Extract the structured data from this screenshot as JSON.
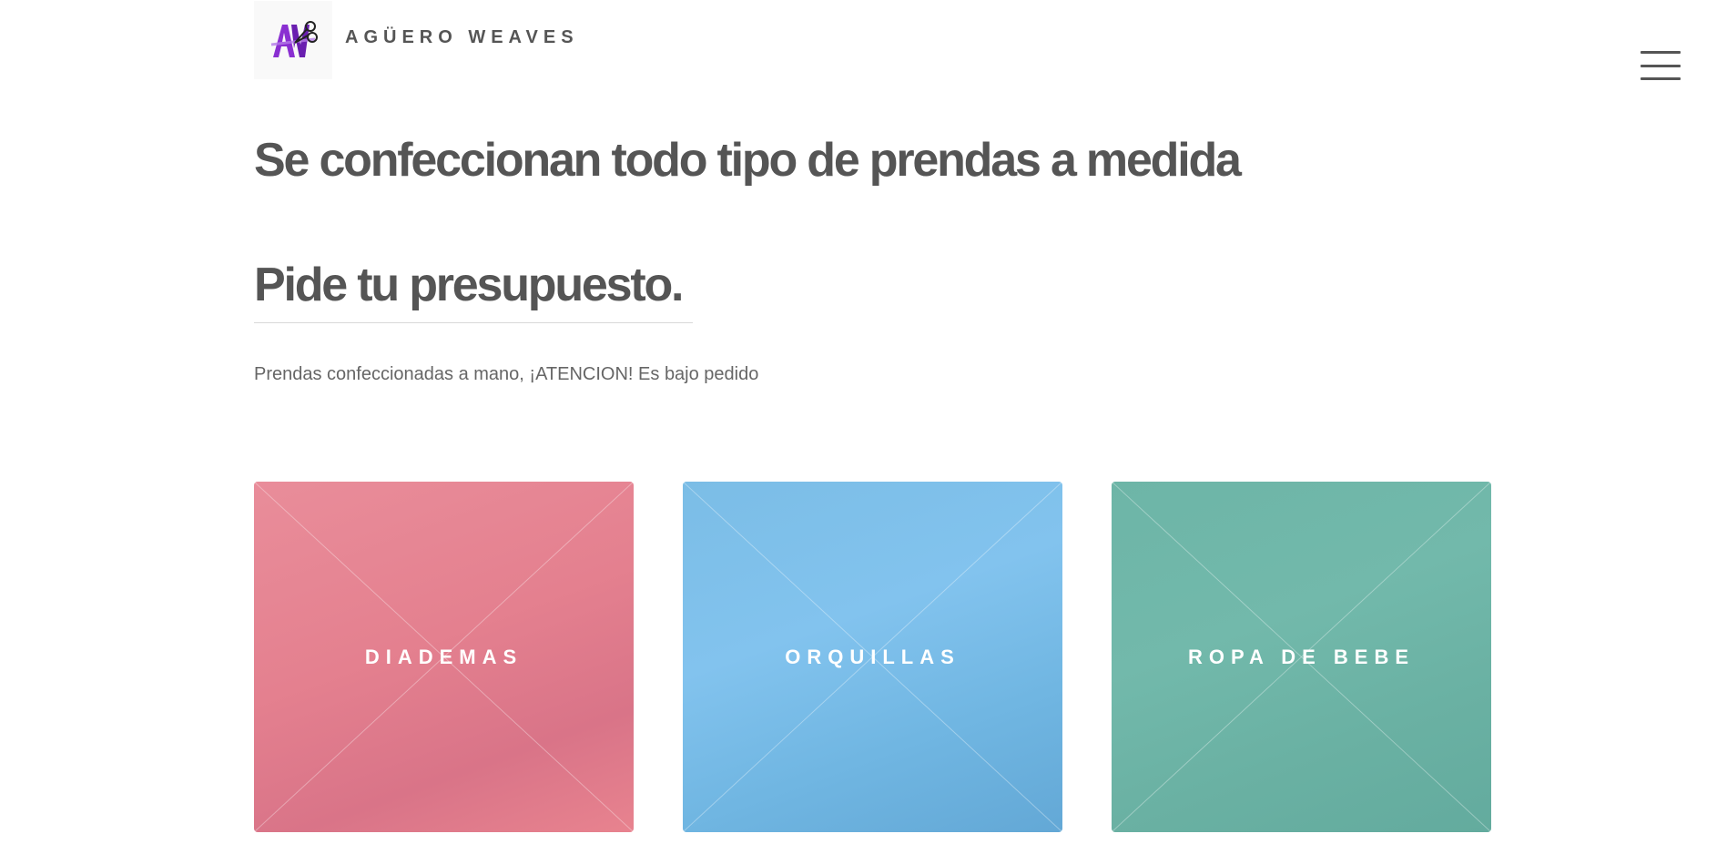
{
  "header": {
    "logo_alt": "AW",
    "site_title": "AGÜERO WEAVES",
    "menu_icon": "hamburger-menu-icon"
  },
  "main": {
    "headline": "Se confeccionan todo tipo de prendas a medida",
    "subheadline": "Pide tu presupuesto.",
    "intro": "Prendas confeccionadas a mano, ¡ATENCION! Es bajo pedido"
  },
  "tiles": [
    {
      "label": "DIADEMAS",
      "color": "#e4808f"
    },
    {
      "label": "ORQUILLAS",
      "color": "#75b9e6"
    },
    {
      "label": "ROPA DE BEBE",
      "color": "#6ab3a5"
    }
  ],
  "colors": {
    "text": "#555555",
    "logo_purple": "#7b2fbf"
  }
}
